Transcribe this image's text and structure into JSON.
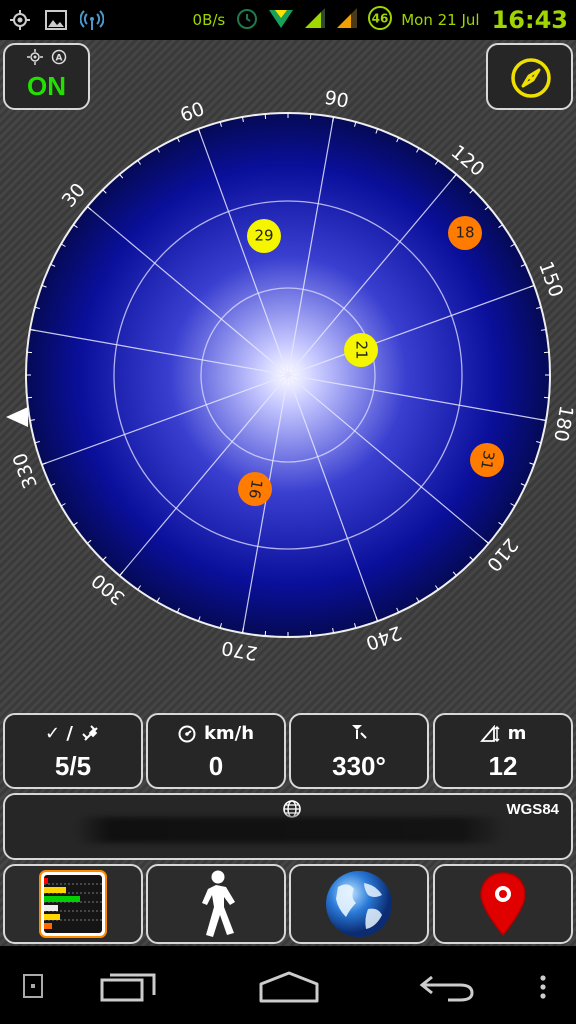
{
  "status_bar": {
    "icons": [
      "gps-status-icon",
      "image-notification-icon",
      "wifi-hotspot-icon",
      "alarm-icon",
      "data-transfer-icon",
      "signal-sim1-icon",
      "signal-sim2-icon",
      "network-46-icon"
    ],
    "speed": "0B/s",
    "network_badge": "46",
    "date": "Mon 21 Jul",
    "time": "16:43",
    "accent_color": "#9fd600"
  },
  "gps_toggle": {
    "label": "ON",
    "icons": [
      "satellite-icon",
      "auto-icon"
    ],
    "label_color": "#22e000"
  },
  "compass_button": {
    "icon": "compass-icon",
    "color": "#f0e000"
  },
  "sky_view": {
    "bearing_labels": [
      {
        "text": "90",
        "angle": 90
      },
      {
        "text": "120",
        "angle": 120
      },
      {
        "text": "150",
        "angle": 150
      },
      {
        "text": "180",
        "angle": 180
      },
      {
        "text": "210",
        "angle": 210
      },
      {
        "text": "240",
        "angle": 240
      },
      {
        "text": "270",
        "angle": 270
      },
      {
        "text": "300",
        "angle": 300
      },
      {
        "text": "330",
        "angle": 330
      },
      {
        "text": "30",
        "angle": 30
      },
      {
        "text": "60",
        "angle": 60
      }
    ],
    "satellites": [
      {
        "prn": "29",
        "color": "#f5f500"
      },
      {
        "prn": "18",
        "color": "#ff7c00"
      },
      {
        "prn": "21",
        "color": "#f5f500"
      },
      {
        "prn": "31",
        "color": "#ff7c00"
      },
      {
        "prn": "16",
        "color": "#ff7c00"
      }
    ],
    "heading_marker": "north-marker-icon"
  },
  "stats": {
    "satellites": {
      "head": "✓ /",
      "value": "5/5"
    },
    "speed": {
      "head": "km/h",
      "value": "0"
    },
    "heading": {
      "head": "",
      "value": "330°"
    },
    "altitude": {
      "head": "m",
      "value": "12"
    }
  },
  "coordinates": {
    "datum": "WGS84",
    "value": ""
  },
  "nav": [
    "signal-bars-button",
    "walking-button",
    "globe-button",
    "map-pin-button"
  ]
}
